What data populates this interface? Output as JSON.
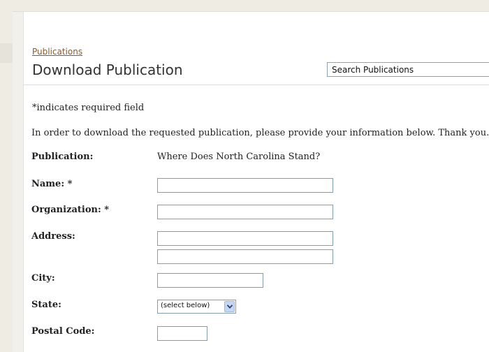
{
  "breadcrumb": "Publications",
  "page_title": "Download Publication",
  "search": {
    "placeholder": "Search Publications"
  },
  "form": {
    "required_note": "*indicates required field",
    "intro": "In order to download the requested publication, please provide your information below. Thank you.",
    "publication_label": "Publication:",
    "publication_value": "Where Does North Carolina Stand?",
    "name_label": "Name: *",
    "organization_label": "Organization: *",
    "address_label": "Address:",
    "city_label": "City:",
    "state_label": "State:",
    "state_selected": "(select below)",
    "postal_label": "Postal Code:"
  },
  "icons": {
    "state_select": "chevron-down-icon"
  }
}
